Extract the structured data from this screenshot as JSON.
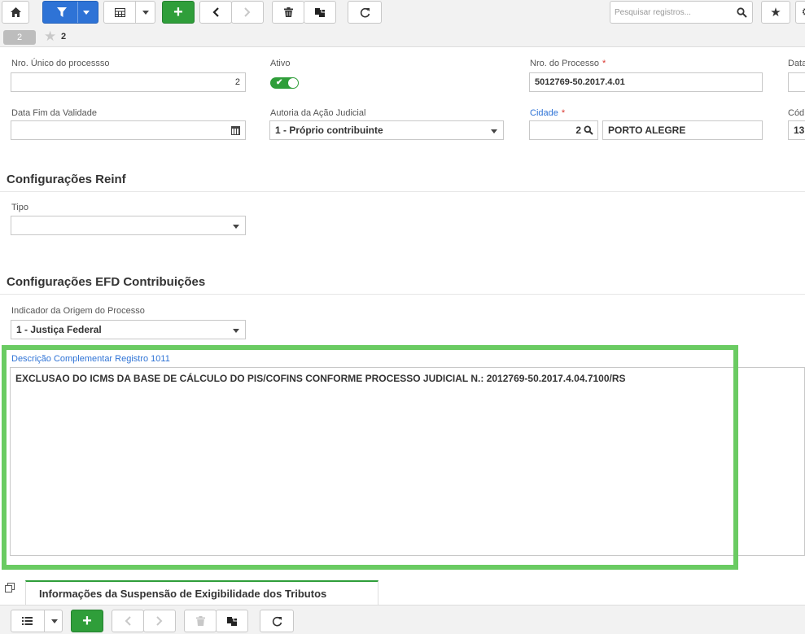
{
  "toolbar": {
    "home_icon": "home-icon",
    "search_placeholder": "Pesquisar registros..."
  },
  "record_bar": {
    "record_number": "2",
    "favorites_count": "2"
  },
  "form": {
    "nro_unico": {
      "label": "Nro. Único do processso",
      "value": "2"
    },
    "ativo": {
      "label": "Ativo",
      "checked": true
    },
    "nro_processo": {
      "label": "Nro. do Processo",
      "required_mark": "*",
      "value": "5012769-50.2017.4.01"
    },
    "data_partial": {
      "label": "Data"
    },
    "data_fim": {
      "label": "Data Fim da Validade",
      "value": ""
    },
    "autoria": {
      "label": "Autoria da Ação Judicial",
      "value": "1 - Próprio contribuinte"
    },
    "cidade": {
      "label": "Cidade",
      "required_mark": "*",
      "code": "2",
      "name": "PORTO ALEGRE"
    },
    "codigo_partial": {
      "label": "Cód",
      "value": "13"
    }
  },
  "section_reinf": {
    "title": "Configurações Reinf",
    "tipo": {
      "label": "Tipo",
      "value": ""
    }
  },
  "section_efd": {
    "title": "Configurações EFD Contribuições",
    "indicador": {
      "label": "Indicador da Origem do Processo",
      "value": "1 - Justiça Federal"
    },
    "descricao": {
      "label": "Descrição Complementar Registro 1011",
      "value": "EXCLUSAO DO ICMS DA BASE DE CÁLCULO DO PIS/COFINS CONFORME PROCESSO JUDICIAL N.: 2012769-50.2017.4.04.7100/RS"
    }
  },
  "detail_tab": {
    "label": "Informações da Suspensão de Exigibilidade dos Tributos"
  },
  "colors": {
    "primary_blue": "#2e73d6",
    "success_green": "#2f9e3a",
    "highlight_frame": "#6acb62",
    "required_red": "#d9362f"
  }
}
